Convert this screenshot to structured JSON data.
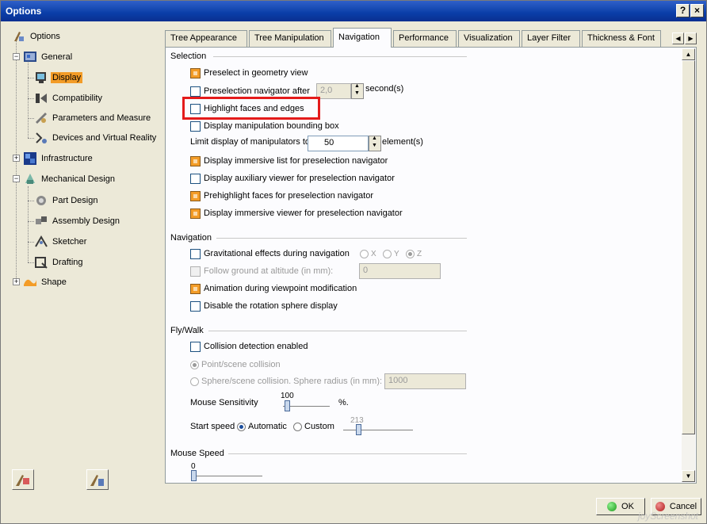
{
  "window": {
    "title": "Options",
    "help_label": "?",
    "close_label": "×"
  },
  "tree": {
    "items": [
      {
        "label": "Options",
        "icon": "options-icon"
      },
      {
        "label": "General",
        "icon": "general-icon"
      },
      {
        "label": "Display",
        "icon": "display-icon",
        "selected": true
      },
      {
        "label": "Compatibility",
        "icon": "compatibility-icon"
      },
      {
        "label": "Parameters and Measure",
        "icon": "parameters-icon"
      },
      {
        "label": "Devices and Virtual Reality",
        "icon": "devices-icon"
      },
      {
        "label": "Infrastructure",
        "icon": "infrastructure-icon"
      },
      {
        "label": "Mechanical Design",
        "icon": "mechanical-design-icon"
      },
      {
        "label": "Part Design",
        "icon": "part-design-icon"
      },
      {
        "label": "Assembly Design",
        "icon": "assembly-design-icon"
      },
      {
        "label": "Sketcher",
        "icon": "sketcher-icon"
      },
      {
        "label": "Drafting",
        "icon": "drafting-icon"
      },
      {
        "label": "Shape",
        "icon": "shape-icon"
      }
    ]
  },
  "tabs": [
    {
      "label": "Tree Appearance"
    },
    {
      "label": "Tree Manipulation"
    },
    {
      "label": "Navigation",
      "active": true
    },
    {
      "label": "Performance"
    },
    {
      "label": "Visualization"
    },
    {
      "label": "Layer Filter"
    },
    {
      "label": "Thickness & Font"
    }
  ],
  "selection": {
    "title": "Selection",
    "preselect_geometry": "Preselect in geometry view",
    "preselection_navigator_after": "Preselection navigator after",
    "preselection_navigator_value": "2,0",
    "preselection_navigator_unit": "second(s)",
    "highlight_faces": "Highlight faces and edges",
    "display_bounding_box": "Display manipulation bounding box",
    "limit_display": "Limit display of manipulators to",
    "limit_display_value": "50",
    "limit_display_unit": "element(s)",
    "display_immersive_list": "Display immersive list for preselection navigator",
    "display_auxiliary_viewer": "Display auxiliary viewer for preselection navigator",
    "prehighlight_faces": "Prehighlight faces for preselection navigator",
    "display_immersive_viewer": "Display immersive viewer for preselection navigator"
  },
  "navigation": {
    "title": "Navigation",
    "gravitational": "Gravitational effects during navigation",
    "axis_x": "X",
    "axis_y": "Y",
    "axis_z": "Z",
    "follow_ground": "Follow ground at altitude (in mm):",
    "follow_ground_value": "0",
    "animation": "Animation during viewpoint modification",
    "disable_rotation": "Disable the rotation sphere display"
  },
  "flywalk": {
    "title": "Fly/Walk",
    "collision": "Collision detection enabled",
    "point_scene": "Point/scene collision",
    "sphere_scene": "Sphere/scene collision. Sphere radius (in mm):",
    "sphere_radius_value": "1000",
    "mouse_sensitivity": "Mouse Sensitivity",
    "mouse_sensitivity_value": "100",
    "mouse_sensitivity_unit": "%.",
    "start_speed": "Start speed",
    "automatic": "Automatic",
    "custom": "Custom",
    "custom_value": "213"
  },
  "mouse_speed": {
    "title": "Mouse Speed",
    "value": "0"
  },
  "buttons": {
    "ok": "OK",
    "cancel": "Cancel"
  },
  "colors": {
    "accent": "#f39c27",
    "title_bar": "#0a3ea8",
    "highlight_box": "#e41b1b"
  },
  "watermark": "joyScreenshot"
}
